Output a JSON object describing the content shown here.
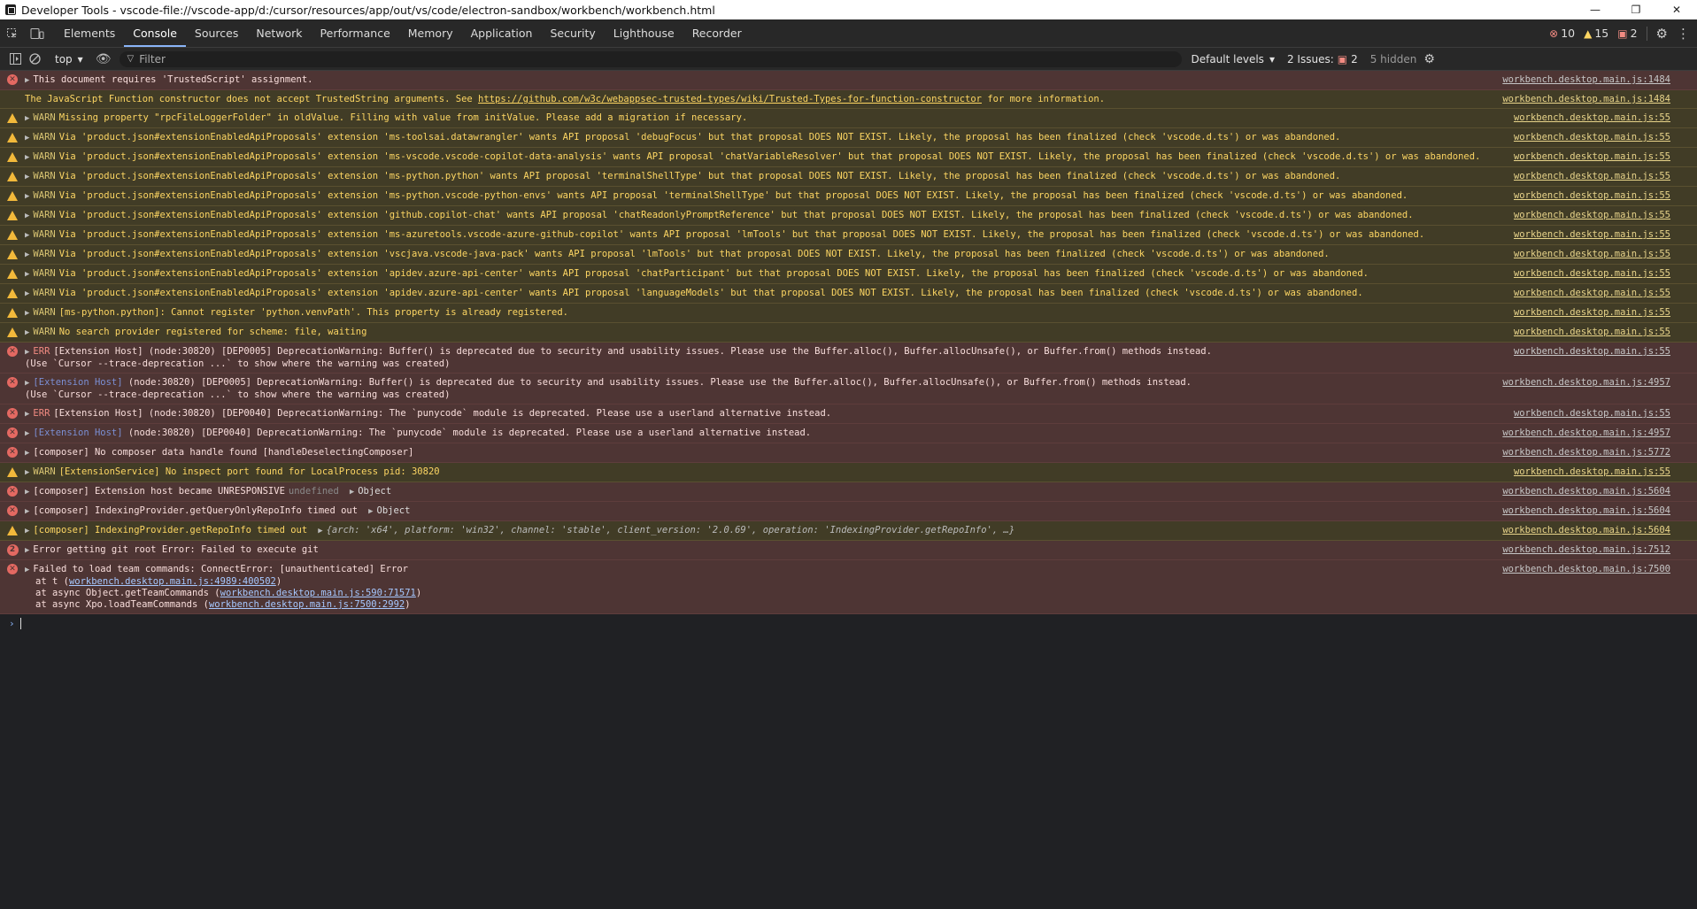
{
  "window": {
    "title": "Developer Tools - vscode-file://vscode-app/d:/cursor/resources/app/out/vs/code/electron-sandbox/workbench/workbench.html",
    "controls": {
      "minimize": "—",
      "restore": "❐",
      "close": "✕"
    }
  },
  "tabs": [
    {
      "label": "Elements"
    },
    {
      "label": "Console",
      "active": true
    },
    {
      "label": "Sources"
    },
    {
      "label": "Network"
    },
    {
      "label": "Performance"
    },
    {
      "label": "Memory"
    },
    {
      "label": "Application"
    },
    {
      "label": "Security"
    },
    {
      "label": "Lighthouse"
    },
    {
      "label": "Recorder"
    }
  ],
  "counters": {
    "errors": "10",
    "warnings": "15",
    "issues": "2"
  },
  "toolbar": {
    "context": "top",
    "filter_placeholder": "Filter",
    "levels": "Default levels",
    "issues_label": "2 Issues:",
    "issues_count": "2",
    "hidden": "5 hidden"
  },
  "messages": [
    {
      "type": "err",
      "text": "This document requires 'TrustedScript' assignment.",
      "src": "workbench.desktop.main.js:1484"
    },
    {
      "type": "info",
      "text_before": "The JavaScript Function constructor does not accept TrustedString arguments. See ",
      "link": "https://github.com/w3c/webappsec-trusted-types/wiki/Trusted-Types-for-function-constructor",
      "text_after": " for more information.",
      "src": "workbench.desktop.main.js:1484"
    },
    {
      "type": "warn",
      "level": "WARN",
      "text": "Missing property \"rpcFileLoggerFolder\" in oldValue. Filling with value from initValue. Please add a migration if necessary.",
      "src": "workbench.desktop.main.js:55"
    },
    {
      "type": "warn",
      "level": "WARN",
      "text": "Via 'product.json#extensionEnabledApiProposals' extension 'ms-toolsai.datawrangler' wants API proposal 'debugFocus' but that proposal DOES NOT EXIST. Likely, the proposal has been finalized (check 'vscode.d.ts') or was abandoned.",
      "src": "workbench.desktop.main.js:55"
    },
    {
      "type": "warn",
      "level": "WARN",
      "text": "Via 'product.json#extensionEnabledApiProposals' extension 'ms-vscode.vscode-copilot-data-analysis' wants API proposal 'chatVariableResolver' but that proposal DOES NOT EXIST. Likely, the proposal has been finalized (check 'vscode.d.ts') or was abandoned.",
      "src": "workbench.desktop.main.js:55"
    },
    {
      "type": "warn",
      "level": "WARN",
      "text": "Via 'product.json#extensionEnabledApiProposals' extension 'ms-python.python' wants API proposal 'terminalShellType' but that proposal DOES NOT EXIST. Likely, the proposal has been finalized (check 'vscode.d.ts') or was abandoned.",
      "src": "workbench.desktop.main.js:55"
    },
    {
      "type": "warn",
      "level": "WARN",
      "text": "Via 'product.json#extensionEnabledApiProposals' extension 'ms-python.vscode-python-envs' wants API proposal 'terminalShellType' but that proposal DOES NOT EXIST. Likely, the proposal has been finalized (check 'vscode.d.ts') or was abandoned.",
      "src": "workbench.desktop.main.js:55"
    },
    {
      "type": "warn",
      "level": "WARN",
      "text": "Via 'product.json#extensionEnabledApiProposals' extension 'github.copilot-chat' wants API proposal 'chatReadonlyPromptReference' but that proposal DOES NOT EXIST. Likely, the proposal has been finalized (check 'vscode.d.ts') or was abandoned.",
      "src": "workbench.desktop.main.js:55"
    },
    {
      "type": "warn",
      "level": "WARN",
      "text": "Via 'product.json#extensionEnabledApiProposals' extension 'ms-azuretools.vscode-azure-github-copilot' wants API proposal 'lmTools' but that proposal DOES NOT EXIST. Likely, the proposal has been finalized (check 'vscode.d.ts') or was abandoned.",
      "src": "workbench.desktop.main.js:55"
    },
    {
      "type": "warn",
      "level": "WARN",
      "text": "Via 'product.json#extensionEnabledApiProposals' extension 'vscjava.vscode-java-pack' wants API proposal 'lmTools' but that proposal DOES NOT EXIST. Likely, the proposal has been finalized (check 'vscode.d.ts') or was abandoned.",
      "src": "workbench.desktop.main.js:55"
    },
    {
      "type": "warn",
      "level": "WARN",
      "text": "Via 'product.json#extensionEnabledApiProposals' extension 'apidev.azure-api-center' wants API proposal 'chatParticipant' but that proposal DOES NOT EXIST. Likely, the proposal has been finalized (check 'vscode.d.ts') or was abandoned.",
      "src": "workbench.desktop.main.js:55"
    },
    {
      "type": "warn",
      "level": "WARN",
      "text": "Via 'product.json#extensionEnabledApiProposals' extension 'apidev.azure-api-center' wants API proposal 'languageModels' but that proposal DOES NOT EXIST. Likely, the proposal has been finalized (check 'vscode.d.ts') or was abandoned.",
      "src": "workbench.desktop.main.js:55"
    },
    {
      "type": "warn",
      "level": "WARN",
      "text": "[ms-python.python]: Cannot register 'python.venvPath'. This property is already registered.",
      "src": "workbench.desktop.main.js:55"
    },
    {
      "type": "warn",
      "level": "WARN",
      "text": "No search provider registered for scheme: file, waiting",
      "src": "workbench.desktop.main.js:55"
    },
    {
      "type": "err",
      "level": "ERR",
      "text": "[Extension Host] (node:30820) [DEP0005] DeprecationWarning: Buffer() is deprecated due to security and usability issues. Please use the Buffer.alloc(), Buffer.allocUnsafe(), or Buffer.from() methods instead.\n(Use `Cursor --trace-deprecation ...` to show where the warning was created)",
      "src": "workbench.desktop.main.js:55"
    },
    {
      "type": "err",
      "exthost": "[Extension Host]",
      "text": " (node:30820) [DEP0005] DeprecationWarning: Buffer() is deprecated due to security and usability issues. Please use the Buffer.alloc(), Buffer.allocUnsafe(), or Buffer.from() methods instead.\n(Use `Cursor --trace-deprecation ...` to show where the warning was created)",
      "src": "workbench.desktop.main.js:4957"
    },
    {
      "type": "err",
      "level": "ERR",
      "text": "[Extension Host] (node:30820) [DEP0040] DeprecationWarning: The `punycode` module is deprecated. Please use a userland alternative instead.",
      "src": "workbench.desktop.main.js:55"
    },
    {
      "type": "err",
      "exthost": "[Extension Host]",
      "text": " (node:30820) [DEP0040] DeprecationWarning: The `punycode` module is deprecated. Please use a userland alternative instead.",
      "src": "workbench.desktop.main.js:4957"
    },
    {
      "type": "err",
      "text": "[composer] No composer data handle found [handleDeselectingComposer]",
      "src": "workbench.desktop.main.js:5772"
    },
    {
      "type": "warn",
      "level": "WARN",
      "text": "[ExtensionService] No inspect port found for LocalProcess pid: 30820",
      "src": "workbench.desktop.main.js:55"
    },
    {
      "type": "err",
      "text": "[composer] Extension host became UNRESPONSIVE",
      "undef": "undefined",
      "obj": "Object",
      "src": "workbench.desktop.main.js:5604"
    },
    {
      "type": "err",
      "text": "[composer] IndexingProvider.getQueryOnlyRepoInfo timed out",
      "obj": "Object",
      "src": "workbench.desktop.main.js:5604"
    },
    {
      "type": "warn",
      "text": "[composer] IndexingProvider.getRepoInfo timed out",
      "preview": "{arch: 'x64', platform: 'win32', channel: 'stable', client_version: '2.0.69', operation: 'IndexingProvider.getRepoInfo', …}",
      "src": "workbench.desktop.main.js:5604"
    },
    {
      "type": "err",
      "count": "2",
      "text": "Error getting git root Error: Failed to execute git",
      "src": "workbench.desktop.main.js:7512"
    },
    {
      "type": "err",
      "text": "Failed to load team commands: ConnectError: [unauthenticated] Error",
      "stack": [
        {
          "prefix": "at t (",
          "link": "workbench.desktop.main.js:4989:400502",
          "suffix": ")"
        },
        {
          "prefix": "at async Object.getTeamCommands (",
          "link": "workbench.desktop.main.js:590:71571",
          "suffix": ")"
        },
        {
          "prefix": "at async Xpo.loadTeamCommands (",
          "link": "workbench.desktop.main.js:7500:2992",
          "suffix": ")"
        }
      ],
      "src": "workbench.desktop.main.js:7500"
    }
  ],
  "prompt": "›"
}
